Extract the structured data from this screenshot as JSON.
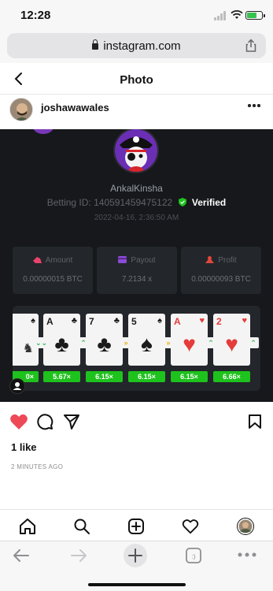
{
  "status_bar": {
    "time": "12:28"
  },
  "browser": {
    "domain": "instagram.com"
  },
  "ig_header": {
    "title": "Photo"
  },
  "post": {
    "author": "joshawawales",
    "likes": "1 like",
    "time_ago": "2 MINUTES AGO"
  },
  "bet_card": {
    "username": "AnkalKinsha",
    "betting_id": "Betting ID: 140591459475122",
    "verified_label": "Verified",
    "timestamp": "2022-04-16, 2:36:50 AM",
    "stats": [
      {
        "label": "Amount",
        "value": "0.00000015 BTC",
        "color": "#e8436d"
      },
      {
        "label": "Payout",
        "value": "7.2134 x",
        "color": "#8a4bd6"
      },
      {
        "label": "Profit",
        "value": "0.00000093 BTC",
        "color": "#e0483c"
      }
    ],
    "cards": [
      {
        "rank": "",
        "suit": "♠",
        "color": "black"
      },
      {
        "rank": "A",
        "suit": "♣",
        "color": "black"
      },
      {
        "rank": "7",
        "suit": "♣",
        "color": "black"
      },
      {
        "rank": "5",
        "suit": "♠",
        "color": "black"
      },
      {
        "rank": "A",
        "suit": "♥",
        "color": "red"
      },
      {
        "rank": "2",
        "suit": "♥",
        "color": "red"
      }
    ],
    "arrows": [
      "⌄⌄",
      "⌃",
      "»",
      "»",
      "⌃",
      "⌃"
    ],
    "multipliers": [
      "0×",
      "5.67×",
      "6.15×",
      "6.15×",
      "6.15×",
      "6.66×"
    ]
  },
  "icons": {
    "like": "heart-icon",
    "comment": "comment-icon",
    "share": "send-icon",
    "save": "bookmark-icon"
  }
}
